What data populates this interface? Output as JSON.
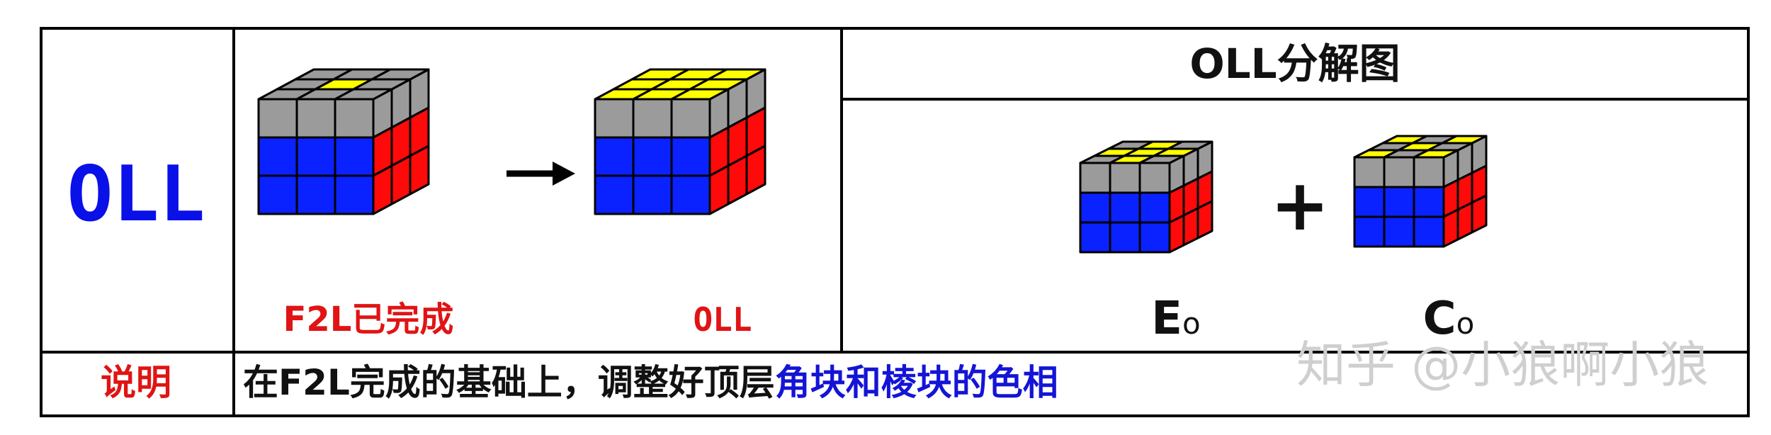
{
  "table": {
    "left_title": "OLL",
    "caption_before": "F2L已完成",
    "caption_after": "OLL",
    "decomposition_title": "OLL分解图",
    "plus_sign": "+",
    "eo_label": {
      "main": "E",
      "sub": "o"
    },
    "co_label": {
      "main": "C",
      "sub": "o"
    },
    "note_label": "说明",
    "note_text_black": "在F2L完成的基础上，调整好顶层",
    "note_text_blue": "角块和棱块的色相"
  },
  "watermark": "知乎 @小狼啊小狼",
  "colors": {
    "cube_blue": "#0a22ff",
    "cube_red": "#ff0a0a",
    "cube_yellow": "#ffff00",
    "cube_gray": "#9b9b9b",
    "title_blue": "#0a10e8",
    "caption_red": "#e01414",
    "note_blue": "#1414d6",
    "text_black": "#111111",
    "watermark_gray": "#cfcfcf"
  },
  "cubes": [
    {
      "name": "cube-f2l-done",
      "top_pattern": [
        "G",
        "G",
        "G",
        "G",
        "Y",
        "G",
        "G",
        "G",
        "G"
      ],
      "front_top_row": "G",
      "right_top_row": "G"
    },
    {
      "name": "cube-oll-done",
      "top_pattern": [
        "Y",
        "Y",
        "Y",
        "Y",
        "Y",
        "Y",
        "Y",
        "Y",
        "Y"
      ],
      "front_top_row": "G",
      "right_top_row": "G"
    },
    {
      "name": "cube-eo",
      "top_pattern": [
        "G",
        "Y",
        "G",
        "Y",
        "Y",
        "Y",
        "G",
        "Y",
        "G"
      ],
      "front_top_row": "G",
      "right_top_row": "G"
    },
    {
      "name": "cube-co",
      "top_pattern": [
        "Y",
        "G",
        "Y",
        "G",
        "Y",
        "G",
        "Y",
        "G",
        "Y"
      ],
      "front_top_row": "G",
      "right_top_row": "G"
    }
  ]
}
